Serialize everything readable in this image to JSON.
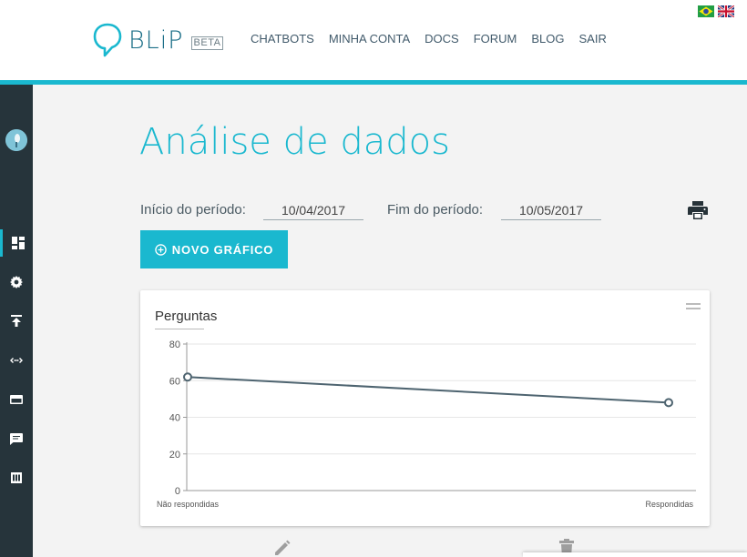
{
  "header": {
    "logo_text": "BLiP",
    "logo_badge": "BETA",
    "nav": [
      "CHATBOTS",
      "MINHA CONTA",
      "DOCS",
      "FORUM",
      "BLOG",
      "SAIR"
    ],
    "flags": [
      "flag-brazil-icon",
      "flag-uk-icon"
    ],
    "accent_color": "#1ab8cf"
  },
  "sidebar": {
    "items": [
      "dashboard-icon",
      "settings-gear-icon",
      "upload-icon",
      "integrations-code-icon",
      "billing-card-icon",
      "chat-message-icon",
      "memory-chip-icon"
    ],
    "active_index": 0
  },
  "main": {
    "title": "Análise de dados",
    "start_label": "Início do período:",
    "start_value": "10/04/2017",
    "end_label": "Fim do período:",
    "end_value": "10/05/2017",
    "new_chart_label": "NOVO GRÁFICO"
  },
  "card": {
    "title": "Perguntas"
  },
  "chart_data": {
    "type": "line",
    "title": "Perguntas",
    "categories": [
      "Não respondidas",
      "Respondidas"
    ],
    "values": [
      62,
      48
    ],
    "ylim": [
      0,
      80
    ],
    "yticks": [
      0,
      20,
      40,
      60,
      80
    ],
    "grid": true,
    "line_color": "#4e6470"
  }
}
